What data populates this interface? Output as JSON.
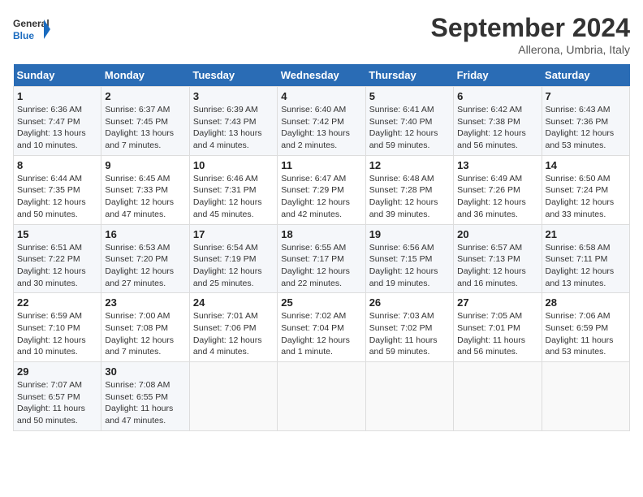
{
  "logo": {
    "general": "General",
    "blue": "Blue"
  },
  "title": "September 2024",
  "location": "Allerona, Umbria, Italy",
  "headers": [
    "Sunday",
    "Monday",
    "Tuesday",
    "Wednesday",
    "Thursday",
    "Friday",
    "Saturday"
  ],
  "weeks": [
    [
      {
        "day": "1",
        "info": "Sunrise: 6:36 AM\nSunset: 7:47 PM\nDaylight: 13 hours and 10 minutes."
      },
      {
        "day": "2",
        "info": "Sunrise: 6:37 AM\nSunset: 7:45 PM\nDaylight: 13 hours and 7 minutes."
      },
      {
        "day": "3",
        "info": "Sunrise: 6:39 AM\nSunset: 7:43 PM\nDaylight: 13 hours and 4 minutes."
      },
      {
        "day": "4",
        "info": "Sunrise: 6:40 AM\nSunset: 7:42 PM\nDaylight: 13 hours and 2 minutes."
      },
      {
        "day": "5",
        "info": "Sunrise: 6:41 AM\nSunset: 7:40 PM\nDaylight: 12 hours and 59 minutes."
      },
      {
        "day": "6",
        "info": "Sunrise: 6:42 AM\nSunset: 7:38 PM\nDaylight: 12 hours and 56 minutes."
      },
      {
        "day": "7",
        "info": "Sunrise: 6:43 AM\nSunset: 7:36 PM\nDaylight: 12 hours and 53 minutes."
      }
    ],
    [
      {
        "day": "8",
        "info": "Sunrise: 6:44 AM\nSunset: 7:35 PM\nDaylight: 12 hours and 50 minutes."
      },
      {
        "day": "9",
        "info": "Sunrise: 6:45 AM\nSunset: 7:33 PM\nDaylight: 12 hours and 47 minutes."
      },
      {
        "day": "10",
        "info": "Sunrise: 6:46 AM\nSunset: 7:31 PM\nDaylight: 12 hours and 45 minutes."
      },
      {
        "day": "11",
        "info": "Sunrise: 6:47 AM\nSunset: 7:29 PM\nDaylight: 12 hours and 42 minutes."
      },
      {
        "day": "12",
        "info": "Sunrise: 6:48 AM\nSunset: 7:28 PM\nDaylight: 12 hours and 39 minutes."
      },
      {
        "day": "13",
        "info": "Sunrise: 6:49 AM\nSunset: 7:26 PM\nDaylight: 12 hours and 36 minutes."
      },
      {
        "day": "14",
        "info": "Sunrise: 6:50 AM\nSunset: 7:24 PM\nDaylight: 12 hours and 33 minutes."
      }
    ],
    [
      {
        "day": "15",
        "info": "Sunrise: 6:51 AM\nSunset: 7:22 PM\nDaylight: 12 hours and 30 minutes."
      },
      {
        "day": "16",
        "info": "Sunrise: 6:53 AM\nSunset: 7:20 PM\nDaylight: 12 hours and 27 minutes."
      },
      {
        "day": "17",
        "info": "Sunrise: 6:54 AM\nSunset: 7:19 PM\nDaylight: 12 hours and 25 minutes."
      },
      {
        "day": "18",
        "info": "Sunrise: 6:55 AM\nSunset: 7:17 PM\nDaylight: 12 hours and 22 minutes."
      },
      {
        "day": "19",
        "info": "Sunrise: 6:56 AM\nSunset: 7:15 PM\nDaylight: 12 hours and 19 minutes."
      },
      {
        "day": "20",
        "info": "Sunrise: 6:57 AM\nSunset: 7:13 PM\nDaylight: 12 hours and 16 minutes."
      },
      {
        "day": "21",
        "info": "Sunrise: 6:58 AM\nSunset: 7:11 PM\nDaylight: 12 hours and 13 minutes."
      }
    ],
    [
      {
        "day": "22",
        "info": "Sunrise: 6:59 AM\nSunset: 7:10 PM\nDaylight: 12 hours and 10 minutes."
      },
      {
        "day": "23",
        "info": "Sunrise: 7:00 AM\nSunset: 7:08 PM\nDaylight: 12 hours and 7 minutes."
      },
      {
        "day": "24",
        "info": "Sunrise: 7:01 AM\nSunset: 7:06 PM\nDaylight: 12 hours and 4 minutes."
      },
      {
        "day": "25",
        "info": "Sunrise: 7:02 AM\nSunset: 7:04 PM\nDaylight: 12 hours and 1 minute."
      },
      {
        "day": "26",
        "info": "Sunrise: 7:03 AM\nSunset: 7:02 PM\nDaylight: 11 hours and 59 minutes."
      },
      {
        "day": "27",
        "info": "Sunrise: 7:05 AM\nSunset: 7:01 PM\nDaylight: 11 hours and 56 minutes."
      },
      {
        "day": "28",
        "info": "Sunrise: 7:06 AM\nSunset: 6:59 PM\nDaylight: 11 hours and 53 minutes."
      }
    ],
    [
      {
        "day": "29",
        "info": "Sunrise: 7:07 AM\nSunset: 6:57 PM\nDaylight: 11 hours and 50 minutes."
      },
      {
        "day": "30",
        "info": "Sunrise: 7:08 AM\nSunset: 6:55 PM\nDaylight: 11 hours and 47 minutes."
      },
      null,
      null,
      null,
      null,
      null
    ]
  ]
}
